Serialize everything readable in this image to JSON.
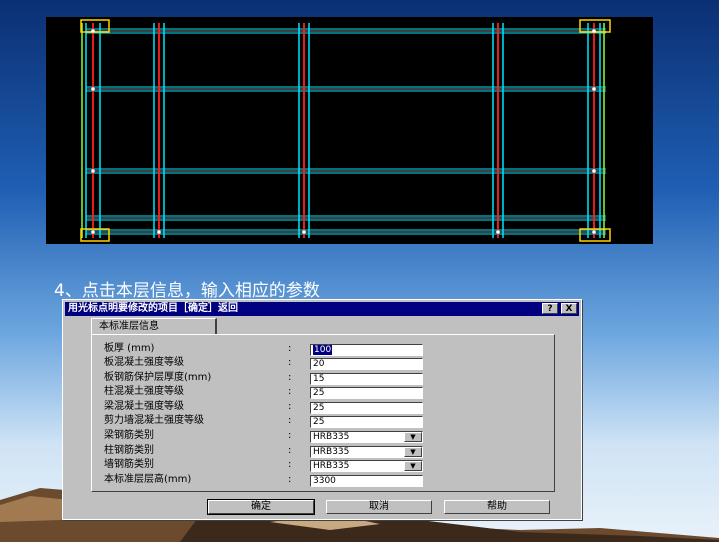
{
  "caption": "4、点击本层信息，输入相应的参数",
  "dialog": {
    "title": "用光标点明要修改的项目［确定］返回",
    "help_btn": "?",
    "close_btn": "X",
    "tab_label": "本标准层信息",
    "rows": [
      {
        "label": "板厚 (mm)",
        "value": "100",
        "type": "text",
        "selected": true
      },
      {
        "label": "板混凝土强度等级",
        "value": "20",
        "type": "text"
      },
      {
        "label": "板钢筋保护层厚度(mm)",
        "value": "15",
        "type": "text"
      },
      {
        "label": "柱混凝土强度等级",
        "value": "25",
        "type": "text"
      },
      {
        "label": "梁混凝土强度等级",
        "value": "25",
        "type": "text"
      },
      {
        "label": "剪力墙混凝土强度等级",
        "value": "25",
        "type": "text"
      },
      {
        "label": "梁钢筋类别",
        "value": "HRB335",
        "type": "select"
      },
      {
        "label": "柱钢筋类别",
        "value": "HRB335",
        "type": "select"
      },
      {
        "label": "墙钢筋类别",
        "value": "HRB335",
        "type": "select"
      },
      {
        "label": "本标准层层高(mm)",
        "value": "3300",
        "type": "text"
      }
    ],
    "colon": ":",
    "buttons": {
      "ok": "确定",
      "cancel": "取消",
      "help": "帮助"
    }
  },
  "colors": {
    "cad_background": "#000000",
    "axis_red": "#ff2020",
    "axis_cyan": "#00e5ff",
    "axis_white": "#ffffff",
    "column_yellow": "#ffd400",
    "beam_green": "#8cff3a",
    "dialog_face": "#c0c0c0",
    "titlebar": "#000080"
  },
  "icons": {
    "dropdown": "chevron-down-icon"
  }
}
